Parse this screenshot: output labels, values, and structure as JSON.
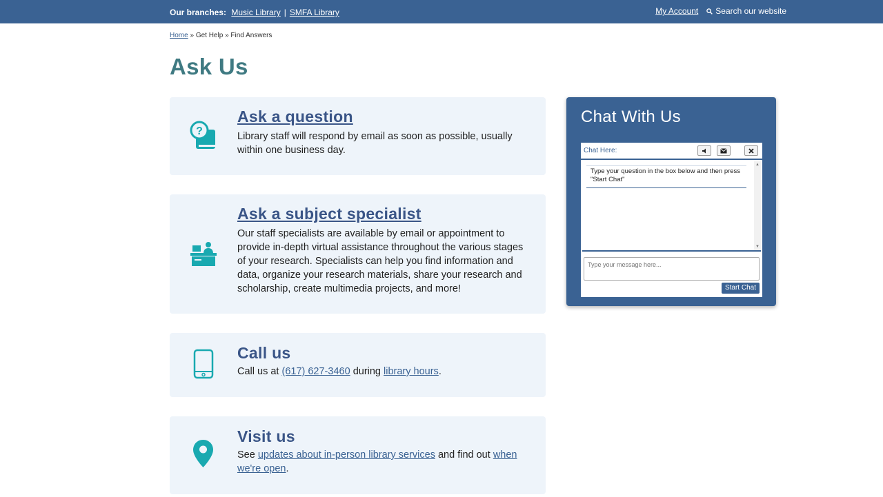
{
  "topbar": {
    "branches_label": "Our branches:",
    "branch_links": [
      "Music Library",
      "SMFA Library"
    ],
    "separator": "|",
    "account": "My Account",
    "search": "Search our website"
  },
  "breadcrumb": {
    "home": "Home",
    "sep1": "»",
    "get_help": "Get Help",
    "sep2": "»",
    "current": "Find Answers"
  },
  "page": {
    "title": "Ask Us"
  },
  "cards": {
    "question": {
      "icon": "question-book-icon",
      "title": "Ask a question",
      "text": "Library staff will respond by email as soon as possible, usually within one business day."
    },
    "specialist": {
      "icon": "desk-person-icon",
      "title": "Ask a subject specialist",
      "text": "Our staff specialists are available by email or appointment to provide in-depth virtual assistance throughout the various stages of your research. Specialists can help you find information and data, organize your research materials, share your research and scholarship, create multimedia projects, and more!"
    },
    "call": {
      "icon": "phone-icon",
      "title": "Call us",
      "text_before": "Call us at",
      "phone": "(617) 627-3460",
      "text_mid": "during",
      "hours_link": "library hours",
      "text_end": "."
    },
    "visit": {
      "icon": "map-pin-icon",
      "title": "Visit us",
      "text_before": "See",
      "updates_link": "updates about in-person library services",
      "text_mid": "and find out",
      "open_link": "when we're open",
      "text_end": "."
    }
  },
  "chat": {
    "title": "Chat With Us",
    "header_label": "Chat Here:",
    "message": "Type your question in the box below and then press \"Start Chat\"",
    "input_placeholder": "Type your message here...",
    "start_button": "Start Chat"
  },
  "colors": {
    "topbar": "#3a6293",
    "accent_teal": "#19a9b0",
    "title_teal": "#3f7a82",
    "card_bg": "#eef4fa"
  }
}
